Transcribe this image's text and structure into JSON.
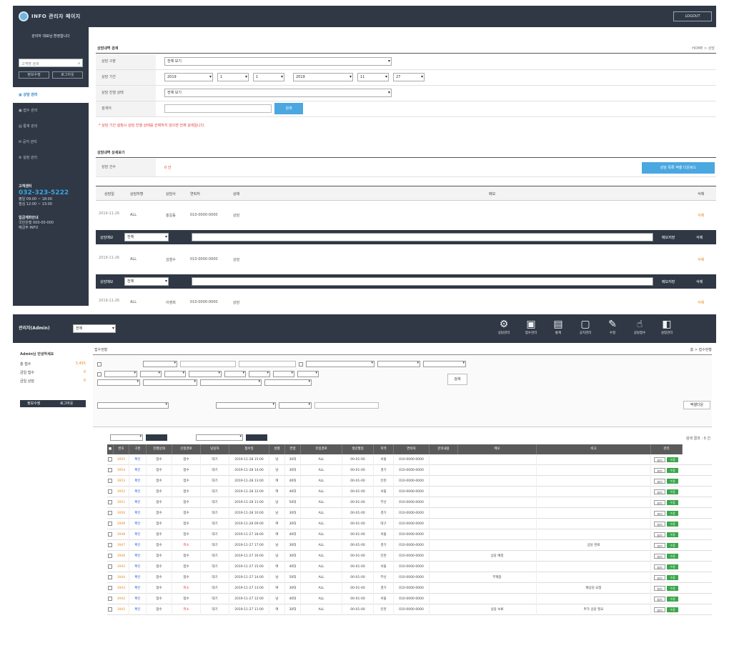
{
  "top": {
    "header_title": "INFO 관리자 페이지",
    "logout_label": "LOGOUT",
    "company": "관리자 대표님 환영합니다",
    "search_placeholder": "고객명 검색",
    "side_btn1": "정보수정",
    "side_btn2": "로그아웃",
    "menu": [
      "상담 관리",
      "접수 관리",
      "통계 관리",
      "공지 관리",
      "설정 관리"
    ],
    "contact_title": "고객센터",
    "phone": "032-323-5222",
    "contact_lines": [
      "평일 09:00 ~ 18:00",
      "점심 12:00 ~ 13:00"
    ],
    "account_title": "입금계좌안내",
    "account_lines": [
      "국민은행 000-00-000",
      "예금주 INFO"
    ],
    "search_section": "상담내역 검색",
    "location": "HOME > 상담",
    "f_labels": [
      "상담 구분",
      "상담 기간",
      "상담 진행 상태",
      "검색어"
    ],
    "f1_value": "전체 보기",
    "f2_values": [
      "2019",
      "1",
      "1",
      "2019",
      "11",
      "27"
    ],
    "f3_value": "전체 보기",
    "search_btn": "검색",
    "warning": "* 상담 기간 설정시 상담 진행 상태를 선택하지 않으면 전체 검색됩니다.",
    "list_section": "상담내역 상세보기",
    "count_label": "상담 건수",
    "count_value": "0 건",
    "excel_btn": "상담 목록 엑셀 다운로드",
    "th": [
      "상담일",
      "상담자명",
      "상담사",
      "연락처",
      "상태",
      "메모",
      "삭제"
    ],
    "rows": [
      {
        "date": "2019-11-26",
        "cat": "ALL",
        "name": "홍길동",
        "tel": "010-0000-0000",
        "status": "상담",
        "del": "삭제"
      },
      {
        "date": "2019-11-26",
        "cat": "ALL",
        "name": "김철수",
        "tel": "010-0000-0000",
        "status": "상담",
        "del": "삭제"
      },
      {
        "date": "2019-11-26",
        "cat": "ALL",
        "name": "이영희",
        "tel": "010-0000-0000",
        "status": "상담",
        "del": "삭제"
      }
    ],
    "memo_label": "상담메모",
    "memo_select": "전체",
    "memo_save": "메모저장",
    "memo_del": "삭제"
  },
  "bottom": {
    "user": "관리자(Admin)",
    "user_select": "전체",
    "icons": [
      {
        "glyph": "⚙",
        "label": "상담관리"
      },
      {
        "glyph": "▣",
        "label": "접수관리"
      },
      {
        "glyph": "▤",
        "label": "통계"
      },
      {
        "glyph": "▢",
        "label": "공지관리"
      },
      {
        "glyph": "✎",
        "label": "수정"
      },
      {
        "glyph": "☝",
        "label": "상담접수"
      },
      {
        "glyph": "◧",
        "label": "설정관리"
      }
    ],
    "side_title": "Admin님 안녕하세요",
    "side_items": [
      {
        "label": "총 접수",
        "value": "3,455"
      },
      {
        "label": "금일 접수",
        "value": "0"
      },
      {
        "label": "금일 상담",
        "value": "0"
      }
    ],
    "side_btn1": "정보수정",
    "side_btn2": "로그아웃",
    "breadcrumb": "접수현황",
    "location": "홈 > 접수현황",
    "search_btn": "검색",
    "excel_btn": "엑셀다운",
    "total": "검색 결과 : 0 건",
    "cols": [
      "번호",
      "구분",
      "진행상태",
      "신청경로",
      "담당자",
      "접수일",
      "성별",
      "연령",
      "유입경로",
      "생년월일",
      "지역",
      "연락처",
      "문의내용",
      "메모",
      "비고",
      "관리"
    ],
    "rows": [
      {
        "no": "3955",
        "type": "확인",
        "st": "접수",
        "path": "접수",
        "mgr": "대기",
        "date": "2019-11-28 15:00",
        "sex": "남",
        "age": "30대",
        "ch": "ALL",
        "bd": "00-01-00",
        "area": "서울",
        "tel": "010-0000-0000",
        "memo": "",
        "note": ""
      },
      {
        "no": "3954",
        "type": "확인",
        "st": "접수",
        "path": "접수",
        "mgr": "대기",
        "date": "2019-11-28 14:00",
        "sex": "남",
        "age": "30대",
        "ch": "ALL",
        "bd": "00-01-00",
        "area": "경기",
        "tel": "010-0000-0000",
        "memo": "",
        "note": ""
      },
      {
        "no": "3953",
        "type": "확인",
        "st": "접수",
        "path": "접수",
        "mgr": "대기",
        "date": "2019-11-28 13:00",
        "sex": "여",
        "age": "40대",
        "ch": "ALL",
        "bd": "00-01-00",
        "area": "인천",
        "tel": "010-0000-0000",
        "memo": "",
        "note": ""
      },
      {
        "no": "3952",
        "type": "확인",
        "st": "접수",
        "path": "접수",
        "mgr": "대기",
        "date": "2019-11-28 12:00",
        "sex": "여",
        "age": "40대",
        "ch": "ALL",
        "bd": "00-01-00",
        "area": "서울",
        "tel": "010-0000-0000",
        "memo": "",
        "note": ""
      },
      {
        "no": "3951",
        "type": "확인",
        "st": "접수",
        "path": "접수",
        "mgr": "대기",
        "date": "2019-11-28 11:00",
        "sex": "남",
        "age": "50대",
        "ch": "ALL",
        "bd": "00-01-00",
        "area": "부산",
        "tel": "010-0000-0000",
        "memo": "",
        "note": ""
      },
      {
        "no": "3950",
        "type": "확인",
        "st": "접수",
        "path": "접수",
        "mgr": "대기",
        "date": "2019-11-28 10:00",
        "sex": "남",
        "age": "30대",
        "ch": "ALL",
        "bd": "00-01-00",
        "area": "경기",
        "tel": "010-0000-0000",
        "memo": "",
        "note": ""
      },
      {
        "no": "3949",
        "type": "확인",
        "st": "접수",
        "path": "접수",
        "mgr": "대기",
        "date": "2019-11-28 09:00",
        "sex": "여",
        "age": "30대",
        "ch": "ALL",
        "bd": "00-01-00",
        "area": "대구",
        "tel": "010-0000-0000",
        "memo": "",
        "note": ""
      },
      {
        "no": "3948",
        "type": "확인",
        "st": "접수",
        "path": "접수",
        "mgr": "대기",
        "date": "2019-11-27 18:00",
        "sex": "여",
        "age": "40대",
        "ch": "ALL",
        "bd": "00-01-00",
        "area": "서울",
        "tel": "010-0000-0000",
        "memo": "",
        "note": ""
      },
      {
        "no": "3947",
        "type": "확인",
        "st": "접수",
        "path": "취소",
        "mgr": "대기",
        "date": "2019-11-27 17:00",
        "sex": "남",
        "age": "30대",
        "ch": "ALL",
        "bd": "00-01-00",
        "area": "경기",
        "tel": "010-0000-0000",
        "memo": "",
        "note": "상담 완료"
      },
      {
        "no": "3946",
        "type": "확인",
        "st": "접수",
        "path": "접수",
        "mgr": "대기",
        "date": "2019-11-27 16:00",
        "sex": "남",
        "age": "30대",
        "ch": "ALL",
        "bd": "00-01-00",
        "area": "인천",
        "tel": "010-0000-0000",
        "memo": "상담 예정",
        "note": ""
      },
      {
        "no": "3945",
        "type": "확인",
        "st": "접수",
        "path": "접수",
        "mgr": "대기",
        "date": "2019-11-27 15:00",
        "sex": "여",
        "age": "40대",
        "ch": "ALL",
        "bd": "00-01-00",
        "area": "서울",
        "tel": "010-0000-0000",
        "memo": "",
        "note": ""
      },
      {
        "no": "3944",
        "type": "확인",
        "st": "접수",
        "path": "접수",
        "mgr": "대기",
        "date": "2019-11-27 14:00",
        "sex": "남",
        "age": "50대",
        "ch": "ALL",
        "bd": "00-01-00",
        "area": "부산",
        "tel": "010-0000-0000",
        "memo": "부재중",
        "note": ""
      },
      {
        "no": "3943",
        "type": "확인",
        "st": "접수",
        "path": "취소",
        "mgr": "대기",
        "date": "2019-11-27 13:00",
        "sex": "여",
        "age": "30대",
        "ch": "ALL",
        "bd": "00-01-00",
        "area": "경기",
        "tel": "010-0000-0000",
        "memo": "",
        "note": "재상담 요청"
      },
      {
        "no": "3942",
        "type": "확인",
        "st": "접수",
        "path": "접수",
        "mgr": "대기",
        "date": "2019-11-27 12:00",
        "sex": "남",
        "age": "40대",
        "ch": "ALL",
        "bd": "00-01-00",
        "area": "서울",
        "tel": "010-0000-0000",
        "memo": "",
        "note": ""
      },
      {
        "no": "3941",
        "type": "확인",
        "st": "접수",
        "path": "취소",
        "mgr": "대기",
        "date": "2019-11-27 11:00",
        "sex": "여",
        "age": "30대",
        "ch": "ALL",
        "bd": "00-01-00",
        "area": "인천",
        "tel": "010-0000-0000",
        "memo": "상담 보류",
        "note": "추가 상담 필요"
      }
    ],
    "btn_view": "보기",
    "btn_edit": "수정"
  }
}
